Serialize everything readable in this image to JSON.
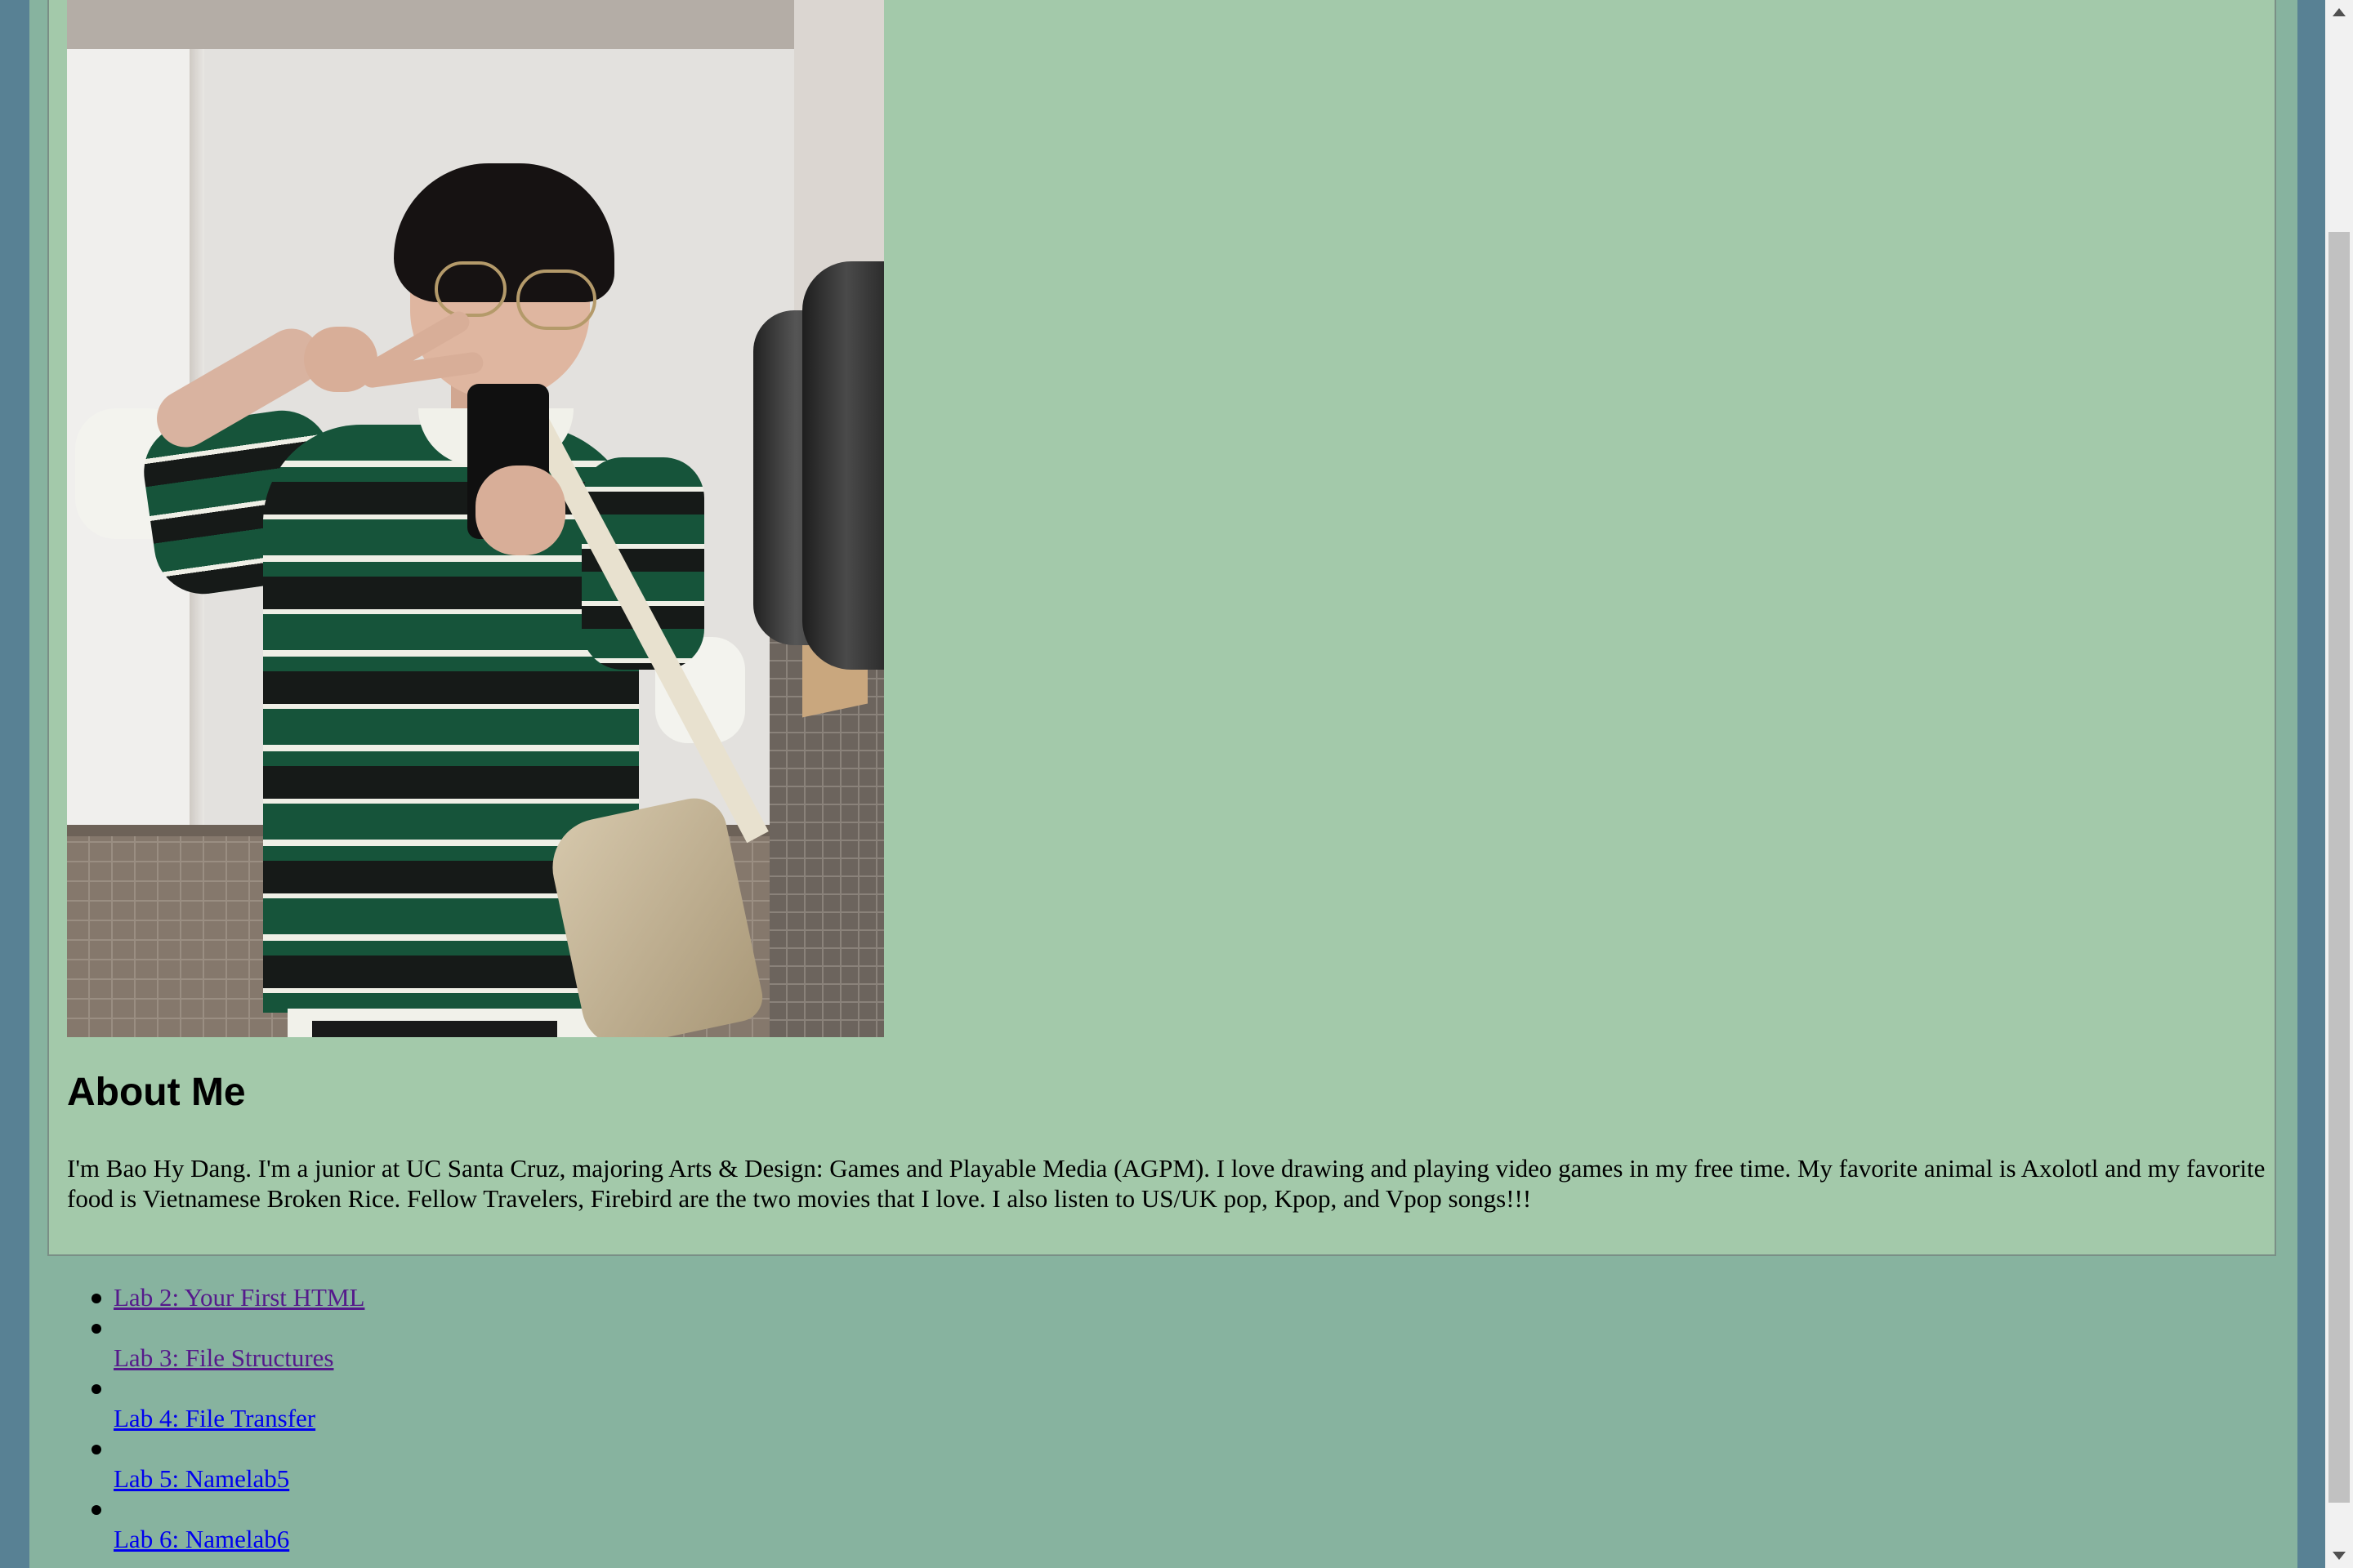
{
  "about": {
    "heading": "About Me",
    "text": "I'm Bao Hy Dang. I'm a junior at UC Santa Cruz, majoring Arts & Design: Games and Playable Media (AGPM). I love drawing and playing video games in my free time. My favorite animal is Axolotl and my favorite food is Vietnamese Broken Rice. Fellow Travelers, Firebird are the two movies that I love. I also listen to US/UK pop, Kpop, and Vpop songs!!!"
  },
  "labs": [
    {
      "label": "Lab 2: Your First HTML",
      "visited": true
    },
    {
      "label": "Lab 3: File Structures",
      "visited": true
    },
    {
      "label": "Lab 4: File Transfer",
      "visited": false
    },
    {
      "label": "Lab 5: Namelab5",
      "visited": false
    },
    {
      "label": "Lab 6: Namelab6",
      "visited": false
    }
  ],
  "colors": {
    "outer_background": "#588194",
    "page_background": "#87b39f",
    "card_background": "#a3c9aa",
    "link_visited": "#551a8b",
    "link_unvisited": "#0000ee"
  },
  "scroll": {
    "position_fraction": 0.25
  }
}
